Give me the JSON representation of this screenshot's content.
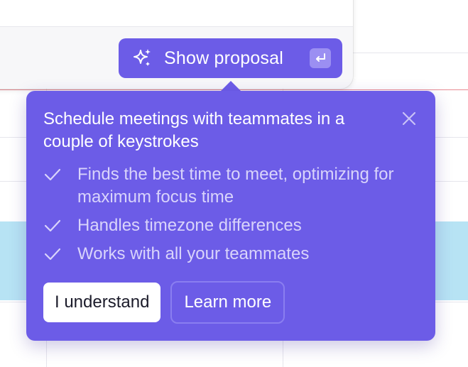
{
  "composer": {
    "show_proposal_label": "Show proposal",
    "spark_icon": "sparkles-icon",
    "enter_key_icon": "enter-key-icon"
  },
  "popover": {
    "title": "Schedule meetings with teammates in a couple of keystrokes",
    "close_icon": "close-icon",
    "features": [
      {
        "icon": "check-icon",
        "text": "Finds the best time to meet, optimizing for maximum focus time"
      },
      {
        "icon": "check-icon",
        "text": "Handles timezone differences"
      },
      {
        "icon": "check-icon",
        "text": "Works with all your teammates"
      }
    ],
    "primary_button": "I understand",
    "secondary_button": "Learn more"
  },
  "colors": {
    "accent": "#6c5ce7",
    "event": "#b7e3f4",
    "now_line": "#e88b93"
  }
}
